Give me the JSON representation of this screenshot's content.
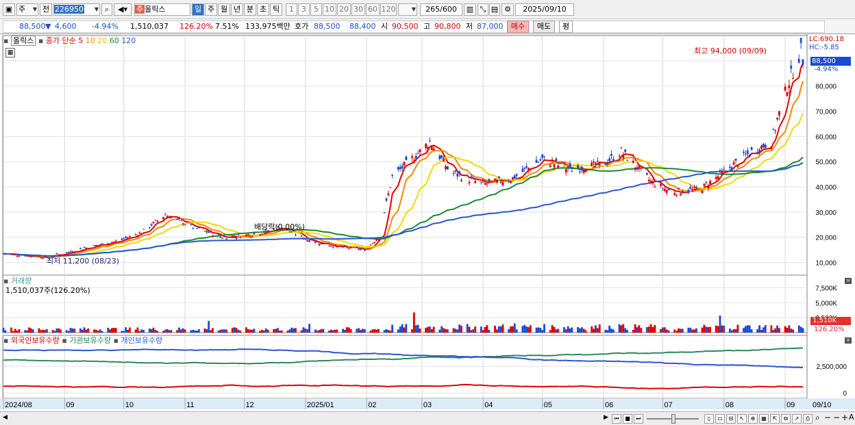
{
  "toolbar": {
    "mode_icon": "chart-window-icon",
    "type_label": "주",
    "prev_label": "전",
    "code_value": "226950",
    "search_icon": "search-icon",
    "sound_icon": "speaker-icon",
    "stock_badge": "주",
    "stock_name": "올릭스",
    "periods": [
      "일",
      "주",
      "월",
      "년",
      "분",
      "초",
      "틱"
    ],
    "selected_period": "일",
    "intervals": [
      "1",
      "3",
      "5",
      "10",
      "20",
      "30",
      "60",
      "120"
    ],
    "count_value": "265",
    "count_total": "/600",
    "date_value": "2025/09/10"
  },
  "quote": {
    "price": "88,500",
    "arrow": "▼",
    "change": "4,600",
    "change_pct": "-4.94%",
    "volume": "1,510,037",
    "volume_ratio": "126.20%",
    "turnover": "7.51%",
    "amount": "133,975백만",
    "ask_label": "호가",
    "ask1": "88,500",
    "ask2": "88,400",
    "open_label": "시",
    "open": "90,500",
    "high_label": "고",
    "high": "90,800",
    "low_label": "저",
    "low": "87,000",
    "buy_label": "매수",
    "sell_label": "매도",
    "avg_label": "평"
  },
  "price_panel": {
    "name_tag": "올릭스",
    "legend_title": "종가 단순",
    "ma_labels": [
      "5",
      "10",
      "20",
      "60",
      "120"
    ],
    "ma_colors": [
      "#e00000",
      "#f08a00",
      "#f5d800",
      "#1a8a30",
      "#2a55d0"
    ],
    "lc": "LC:690.18",
    "hc": "HC:-5.85",
    "last_label": "88,500",
    "last_pct": "-4.94%",
    "high_note": "최고 94,000 (09/09)",
    "low_note": "최저 11,200 (08/23)",
    "dividend_note": "배당락(0.00%)",
    "y_ticks": [
      "90,000",
      "80,000",
      "70,000",
      "60,000",
      "50,000",
      "40,000",
      "30,000",
      "20,000",
      "10,000"
    ]
  },
  "volume_panel": {
    "title": "거래량",
    "value": "1,510,037주(126.20%)",
    "y_ticks": [
      "7,500K",
      "5,000K",
      "2,500K"
    ],
    "last_label": "1,510K",
    "last_pct": "126.20%"
  },
  "holdings_panel": {
    "series": [
      "외국인보유수량",
      "기관보유수량",
      "개인보유수량"
    ],
    "colors": [
      "#e00000",
      "#2a8a5a",
      "#2a55d0"
    ],
    "y_ticks": [
      "2,500,000",
      "0"
    ]
  },
  "x_axis": {
    "labels": [
      "2024/08",
      "09",
      "10",
      "11",
      "12",
      "2025/01",
      "02",
      "03",
      "04",
      "05",
      "06",
      "07",
      "08",
      "09",
      "09/10"
    ]
  },
  "chart_data": {
    "type": "candlestick",
    "price_anchors": [
      [
        "2024/08/01",
        13500
      ],
      [
        "2024/08/23",
        12000
      ],
      [
        "2024/09/10",
        15500
      ],
      [
        "2024/09/30",
        19000
      ],
      [
        "2024/10/10",
        22000
      ],
      [
        "2024/10/22",
        29000
      ],
      [
        "2024/11/05",
        24000
      ],
      [
        "2024/11/20",
        20000
      ],
      [
        "2024/12/05",
        21000
      ],
      [
        "2024/12/20",
        24000
      ],
      [
        "2025/01/02",
        19000
      ],
      [
        "2025/01/15",
        16500
      ],
      [
        "2025/01/31",
        15000
      ],
      [
        "2025/02/07",
        20000
      ],
      [
        "2025/02/14",
        44000
      ],
      [
        "2025/02/28",
        54000
      ],
      [
        "2025/03/05",
        58000
      ],
      [
        "2025/03/15",
        46000
      ],
      [
        "2025/04/01",
        41000
      ],
      [
        "2025/04/15",
        43000
      ],
      [
        "2025/05/01",
        51000
      ],
      [
        "2025/05/15",
        47000
      ],
      [
        "2025/06/01",
        49000
      ],
      [
        "2025/06/10",
        54000
      ],
      [
        "2025/06/25",
        42000
      ],
      [
        "2025/07/05",
        38000
      ],
      [
        "2025/07/20",
        39000
      ],
      [
        "2025/08/01",
        46000
      ],
      [
        "2025/08/15",
        54000
      ],
      [
        "2025/08/25",
        58000
      ],
      [
        "2025/09/02",
        80000
      ],
      [
        "2025/09/09",
        94000
      ],
      [
        "2025/09/10",
        88500
      ]
    ],
    "ylim": [
      5000,
      100000
    ],
    "volume_ylim": [
      0,
      8000000
    ],
    "holdings_ylim": [
      -500000,
      4500000
    ]
  }
}
